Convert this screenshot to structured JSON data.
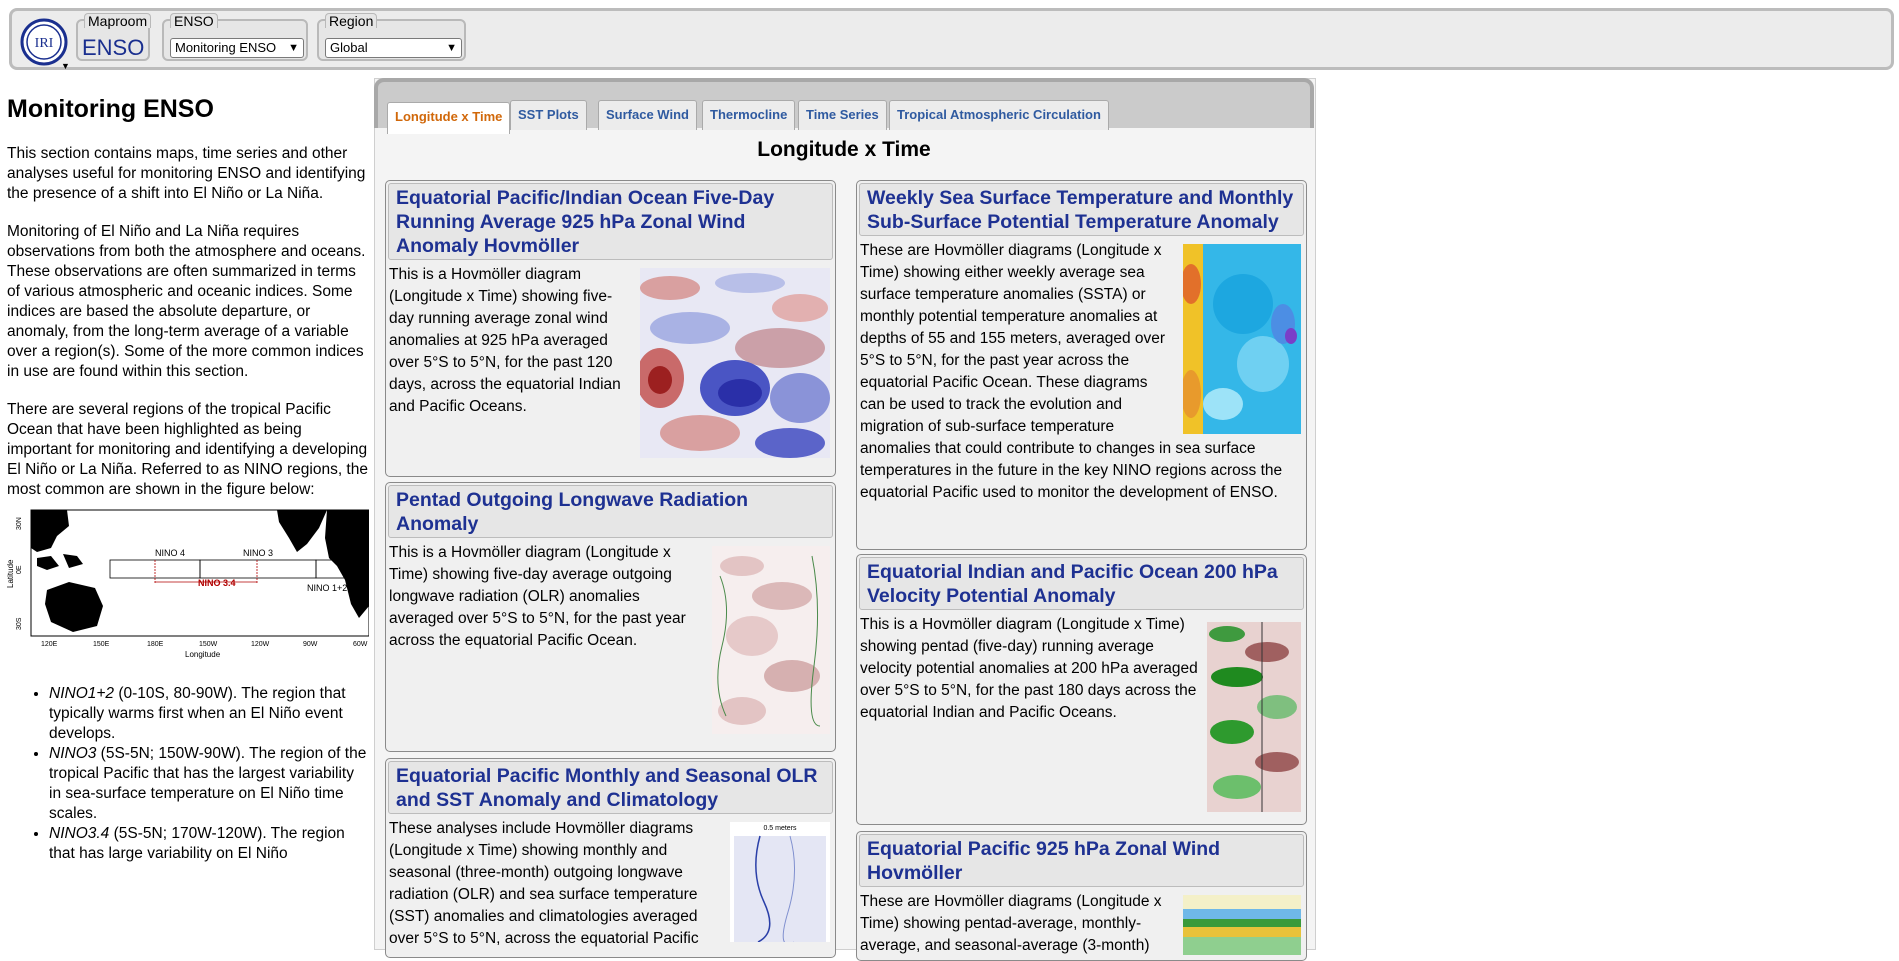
{
  "topbar": {
    "logo_text": "IRI",
    "maproom_legend": "Maproom",
    "maproom_value": "ENSO",
    "enso_legend": "ENSO",
    "enso_selected": "Monitoring ENSO",
    "region_legend": "Region",
    "region_selected": "Global"
  },
  "sidebar": {
    "title": "Monitoring ENSO",
    "p1": "This section contains maps, time series and other analyses useful for monitoring ENSO and identifying the presence of a shift into El Niño or La Niña.",
    "p2": "Monitoring of El Niño and La Niña requires observations from both the atmosphere and oceans. These observations are often summarized in terms of various atmospheric and oceanic indices. Some indices are based the absolute departure, or anomaly, from the long-term average of a variable over a region(s). Some of the more common indices in use are found within this section.",
    "p3": "There are several regions of the tropical Pacific Ocean that have been highlighted as being important for monitoring and identifying a developing El Niño or La Niña. Referred to as NINO regions, the most common are shown in the figure below:",
    "map": {
      "ylabel": "Latitude",
      "xlabel": "Longitude",
      "lat_ticks": [
        "30N",
        "0E",
        "30S"
      ],
      "lon_ticks": [
        "120E",
        "150E",
        "180E",
        "150W",
        "120W",
        "90W",
        "60W"
      ],
      "region_labels": [
        "NINO 4",
        "NINO 3",
        "NINO 3.4",
        "NINO 1+2"
      ]
    },
    "list": [
      {
        "name": "NINO1+2",
        "text": " (0-10S, 80-90W). The region that typically warms first when an El Niño event develops."
      },
      {
        "name": "NINO3",
        "text": " (5S-5N; 150W-90W). The region of the tropical Pacific that has the largest variability in sea-surface temperature on El Niño time scales."
      },
      {
        "name": "NINO3.4",
        "text": " (5S-5N; 170W-120W). The region that has large variability on El Niño"
      }
    ]
  },
  "tabs": [
    {
      "label": "Longitude x Time",
      "active": true
    },
    {
      "label": "SST Plots"
    },
    {
      "label": "Surface Wind"
    },
    {
      "label": "Thermocline"
    },
    {
      "label": "Time Series"
    },
    {
      "label": "Tropical Atmospheric Circulation"
    }
  ],
  "content": {
    "title": "Longitude x Time",
    "cards": [
      {
        "title": "Equatorial Pacific/Indian Ocean Five-Day Running Average 925 hPa Zonal Wind Anomaly Hovmöller",
        "text": "This is a Hovmöller diagram (Longitude x Time) showing five-day running average zonal wind anomalies at 925 hPa averaged over 5°S to 5°N, for the past 120 days, across the equatorial Indian and Pacific Oceans."
      },
      {
        "title": "Pentad Outgoing Longwave Radiation Anomaly",
        "text": "This is a Hovmöller diagram (Longitude x Time) showing five-day average outgoing longwave radiation (OLR) anomalies averaged over 5°S to 5°N, for the past year across the equatorial Pacific Ocean."
      },
      {
        "title": "Equatorial Pacific Monthly and Seasonal OLR and SST Anomaly and Climatology",
        "text": "These analyses include Hovmöller diagrams (Longitude x Time) showing monthly and seasonal (three-month) outgoing longwave radiation (OLR) and sea surface temperature (SST) anomalies and climatologies averaged over 5°S to 5°N, across the equatorial Pacific",
        "thumb_label": "0.5 meters"
      },
      {
        "title": "Weekly Sea Surface Temperature and Monthly Sub-Surface Potential Temperature Anomaly",
        "text": "These are Hovmöller diagrams (Longitude x Time) showing either weekly average sea surface temperature anomalies (SSTA) or monthly potential temperature anomalies at depths of 55 and 155 meters, averaged over 5°S to 5°N, for the past year across the equatorial Pacific Ocean. These diagrams can be used to track the evolution and migration of sub-surface temperature anomalies that could contribute to changes in sea surface temperatures in the future in the key NINO regions across the equatorial Pacific used to monitor the development of ENSO."
      },
      {
        "title": "Equatorial Indian and Pacific Ocean 200 hPa Velocity Potential Anomaly",
        "text": "This is a Hovmöller diagram (Longitude x Time) showing pentad (five-day) running average velocity potential anomalies at 200 hPa averaged over 5°S to 5°N, for the past 180 days across the equatorial Indian and Pacific Oceans."
      },
      {
        "title": "Equatorial Pacific 925 hPa Zonal Wind Hovmöller",
        "text": "These are Hovmöller diagrams (Longitude x Time) showing pentad-average, monthly-average, and seasonal-average (3-month)"
      }
    ]
  },
  "colors": {
    "title_blue": "#1e3192",
    "tab_blue": "#2f5aa0",
    "tab_active": "#d1680a",
    "nino34_red": "#b10000"
  }
}
